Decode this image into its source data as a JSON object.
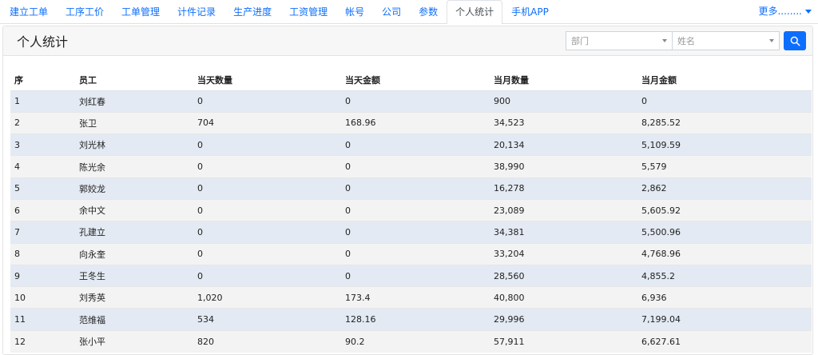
{
  "nav": {
    "tabs": [
      "建立工单",
      "工序工价",
      "工单管理",
      "计件记录",
      "生产进度",
      "工资管理",
      "帐号",
      "公司",
      "参数",
      "个人统计",
      "手机APP"
    ],
    "active_index": 9,
    "more_label": "更多........"
  },
  "header": {
    "title": "个人统计",
    "department_placeholder": "部门",
    "name_placeholder": "姓名",
    "search_icon": "search-icon"
  },
  "table": {
    "columns": [
      "序",
      "员工",
      "当天数量",
      "当天金额",
      "当月数量",
      "当月金额"
    ],
    "rows": [
      [
        "1",
        "刘红春",
        "0",
        "0",
        "900",
        "0"
      ],
      [
        "2",
        "张卫",
        "704",
        "168.96",
        "34,523",
        "8,285.52"
      ],
      [
        "3",
        "刘光林",
        "0",
        "0",
        "20,134",
        "5,109.59"
      ],
      [
        "4",
        "陈光余",
        "0",
        "0",
        "38,990",
        "5,579"
      ],
      [
        "5",
        "郭姣龙",
        "0",
        "0",
        "16,278",
        "2,862"
      ],
      [
        "6",
        "余中文",
        "0",
        "0",
        "23,089",
        "5,605.92"
      ],
      [
        "7",
        "孔建立",
        "0",
        "0",
        "34,381",
        "5,500.96"
      ],
      [
        "8",
        "向永奎",
        "0",
        "0",
        "33,204",
        "4,768.96"
      ],
      [
        "9",
        "王冬生",
        "0",
        "0",
        "28,560",
        "4,855.2"
      ],
      [
        "10",
        "刘秀英",
        "1,020",
        "173.4",
        "40,800",
        "6,936"
      ],
      [
        "11",
        "范维福",
        "534",
        "128.16",
        "29,996",
        "7,199.04"
      ],
      [
        "12",
        "张小平",
        "820",
        "90.2",
        "57,911",
        "6,627.61"
      ]
    ]
  }
}
